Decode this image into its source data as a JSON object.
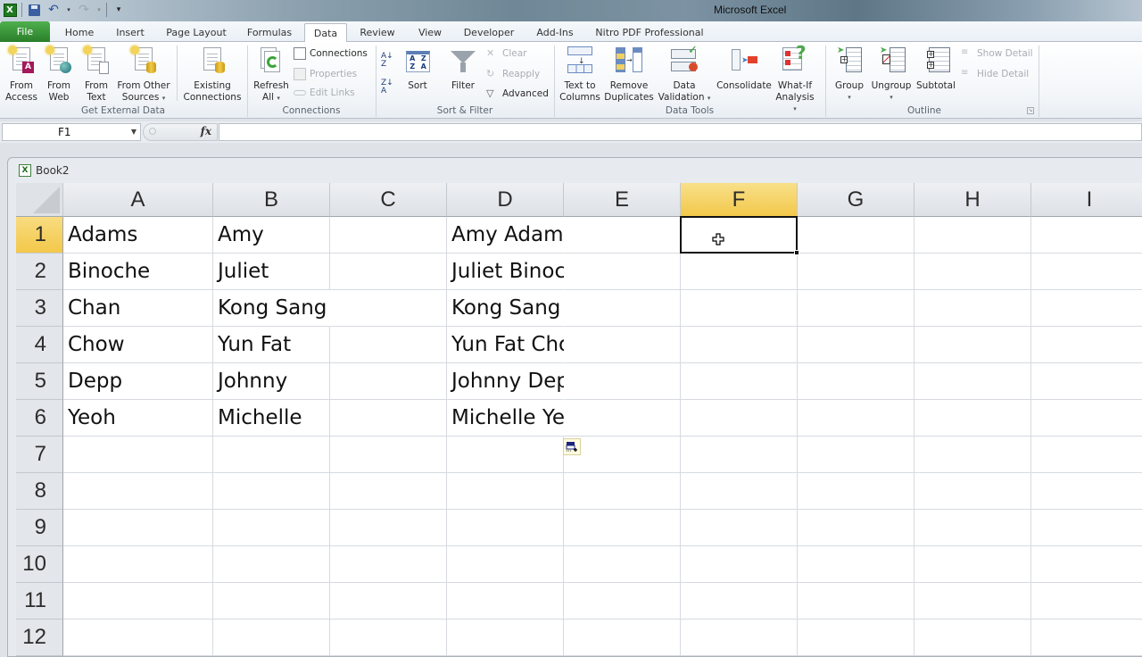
{
  "app": {
    "title": "Microsoft Excel"
  },
  "quick_access": [
    {
      "name": "excel-logo-icon"
    },
    {
      "name": "save-icon"
    },
    {
      "name": "undo-icon"
    },
    {
      "name": "redo-icon"
    },
    {
      "name": "customize-qat-icon"
    }
  ],
  "tabs": [
    {
      "label": "File",
      "active": false
    },
    {
      "label": "Home",
      "active": false
    },
    {
      "label": "Insert",
      "active": false
    },
    {
      "label": "Page Layout",
      "active": false
    },
    {
      "label": "Formulas",
      "active": false
    },
    {
      "label": "Data",
      "active": true
    },
    {
      "label": "Review",
      "active": false
    },
    {
      "label": "View",
      "active": false
    },
    {
      "label": "Developer",
      "active": false
    },
    {
      "label": "Add-Ins",
      "active": false
    },
    {
      "label": "Nitro PDF Professional",
      "active": false
    }
  ],
  "ribbon": {
    "get_external_data": {
      "label": "Get External Data",
      "from_access": [
        "From",
        "Access"
      ],
      "from_web": [
        "From",
        "Web"
      ],
      "from_text": [
        "From",
        "Text"
      ],
      "from_other": [
        "From Other",
        "Sources"
      ],
      "existing": [
        "Existing",
        "Connections"
      ]
    },
    "connections": {
      "label": "Connections",
      "refresh": [
        "Refresh",
        "All"
      ],
      "connections": "Connections",
      "properties": "Properties",
      "edit_links": "Edit Links"
    },
    "sort_filter": {
      "label": "Sort & Filter",
      "sort": "Sort",
      "filter": "Filter",
      "clear": "Clear",
      "reapply": "Reapply",
      "advanced": "Advanced"
    },
    "data_tools": {
      "label": "Data Tools",
      "text_to_columns": [
        "Text to",
        "Columns"
      ],
      "remove_duplicates": [
        "Remove",
        "Duplicates"
      ],
      "data_validation": [
        "Data",
        "Validation"
      ],
      "consolidate": "Consolidate",
      "what_if": [
        "What-If",
        "Analysis"
      ]
    },
    "outline": {
      "label": "Outline",
      "group": "Group",
      "ungroup": "Ungroup",
      "subtotal": "Subtotal",
      "show_detail": "Show Detail",
      "hide_detail": "Hide Detail"
    }
  },
  "formula_bar": {
    "name_box": "F1",
    "fx": "fx",
    "formula": ""
  },
  "workbook": {
    "title": "Book2",
    "columns": [
      "A",
      "B",
      "C",
      "D",
      "E",
      "F",
      "G",
      "H",
      "I"
    ],
    "selected_column": "F",
    "rows": [
      "1",
      "2",
      "3",
      "4",
      "5",
      "6",
      "7",
      "8",
      "9",
      "10",
      "11",
      "12"
    ],
    "selected_row": "1",
    "active_cell": "F1",
    "cells": [
      {
        "A": "Adams",
        "B": "Amy",
        "D": "Amy Adams"
      },
      {
        "A": "Binoche",
        "B": "Juliet",
        "D": "Juliet Binoche"
      },
      {
        "A": "Chan",
        "B": "Kong Sang",
        "D": "Kong Sang Chan"
      },
      {
        "A": "Chow",
        "B": "Yun Fat",
        "D": "Yun Fat Chow"
      },
      {
        "A": "Depp",
        "B": "Johnny",
        "D": "Johnny Depp"
      },
      {
        "A": "Yeoh",
        "B": "Michelle",
        "D": "Michelle Yeoh"
      }
    ]
  },
  "colors": {
    "file_tab": "#3a973a",
    "selected_header": "#f3c84a",
    "active_cell_border": "#111111"
  }
}
